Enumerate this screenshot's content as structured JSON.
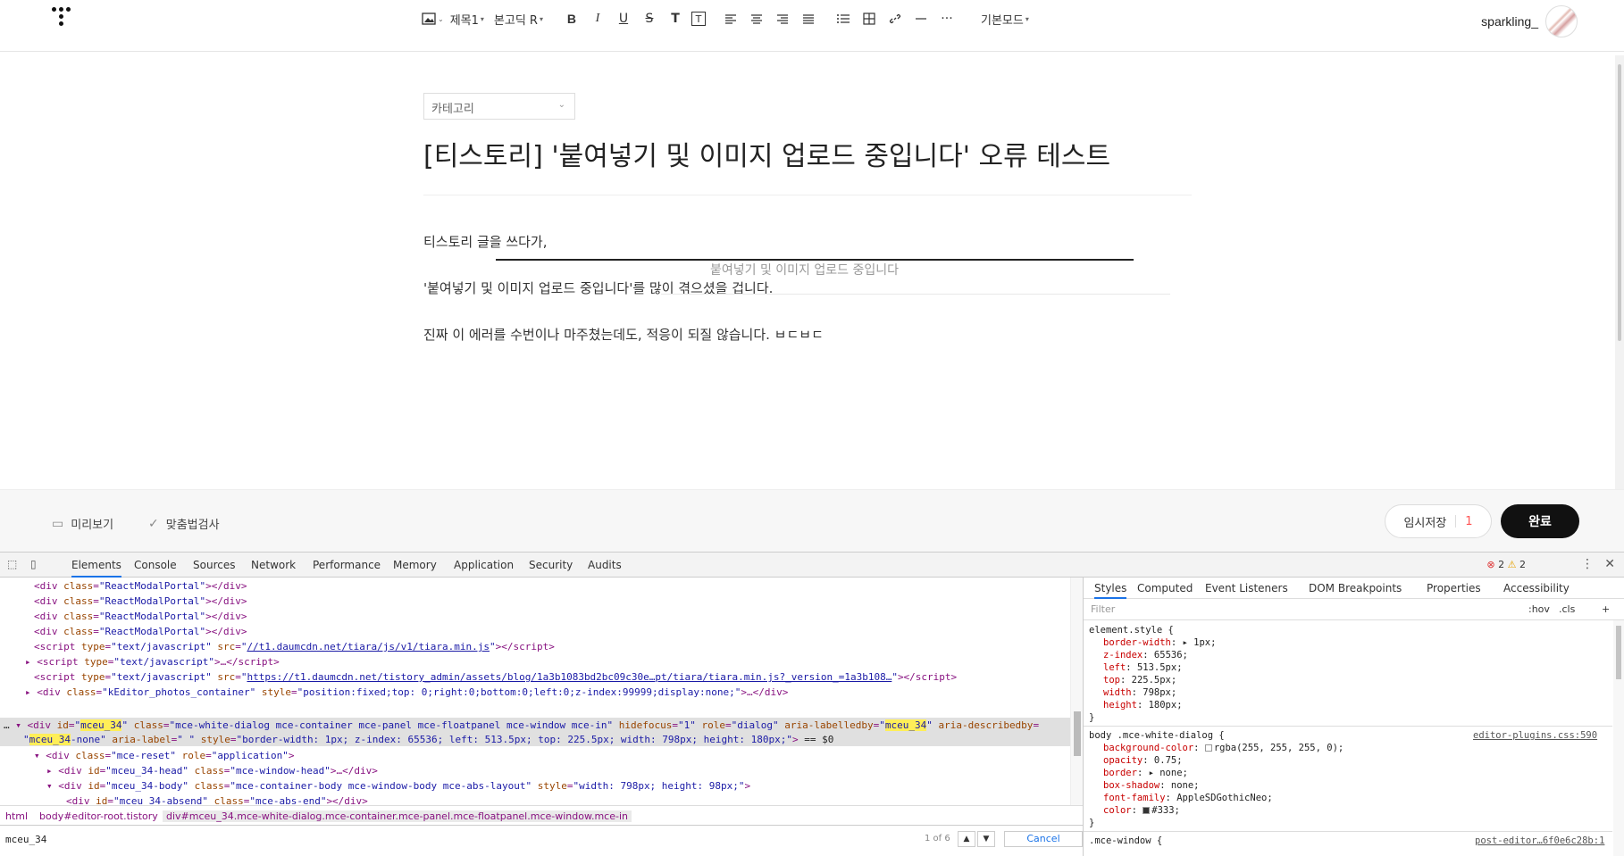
{
  "toolbar": {
    "image_caret": "⌄",
    "heading": "제목1",
    "font": "본고딕 R",
    "bold": "B",
    "italic": "I",
    "underline": "U",
    "strike": "S",
    "text_color": "T",
    "text_bg": "T",
    "more": "···",
    "mode": "기본모드"
  },
  "user": {
    "name": "sparkling_"
  },
  "editor": {
    "category_placeholder": "카테고리",
    "title": "[티스토리] '붙여넣기 및 이미지 업로드 중입니다'  오류 테스트",
    "paragraphs": [
      "티스토리 글을 쓰다가,",
      "'붙여넣기 및 이미지 업로드 중입니다'를 많이 겪으셨을 겁니다.",
      "진짜 이 에러를 수번이나 마주쳤는데도, 적응이 되질 않습니다. ㅂㄷㅂㄷ"
    ],
    "overlay_text": "붙여넣기 및 이미지 업로드 중입니다"
  },
  "footer": {
    "preview": "미리보기",
    "spellcheck": "맞춤법검사",
    "temp_save": "임시저장",
    "temp_count": "1",
    "done": "완료"
  },
  "devtools": {
    "tabs": [
      "Elements",
      "Console",
      "Sources",
      "Network",
      "Performance",
      "Memory",
      "Application",
      "Security",
      "Audits"
    ],
    "errors": "2",
    "warnings": "2",
    "crumbs": [
      "html",
      "body#editor-root.tistory",
      "div#mceu_34.mce-white-dialog.mce-container.mce-panel.mce-floatpanel.mce-window.mce-in"
    ],
    "search_value": "mceu_34",
    "search_count": "1 of 6",
    "cancel": "Cancel",
    "styles_tabs": [
      "Styles",
      "Computed",
      "Event Listeners",
      "DOM Breakpoints",
      "Properties",
      "Accessibility"
    ],
    "filter_placeholder": "Filter",
    "hov": ":hov",
    "cls": ".cls",
    "element_style_selector": "element.style {",
    "element_style": [
      [
        "border-width",
        "▸ 1px;"
      ],
      [
        "z-index",
        "65536;"
      ],
      [
        "left",
        "513.5px;"
      ],
      [
        "top",
        "225.5px;"
      ],
      [
        "width",
        "798px;"
      ],
      [
        "height",
        "180px;"
      ]
    ],
    "rule2_selector": "body .mce-white-dialog {",
    "rule2_source": "editor-plugins.css:590",
    "rule2": [
      [
        "background-color",
        "rgba(255, 255, 255, 0);"
      ],
      [
        "opacity",
        "0.75;"
      ],
      [
        "border",
        "▸ none;"
      ],
      [
        "box-shadow",
        "none;"
      ],
      [
        "font-family",
        "AppleSDGothicNeo;"
      ],
      [
        "color",
        "#333;"
      ]
    ],
    "rule3_selector": ".mce-window {",
    "rule3_source": "post-editor…6f0e6c28b:1",
    "close_brace": "}"
  }
}
